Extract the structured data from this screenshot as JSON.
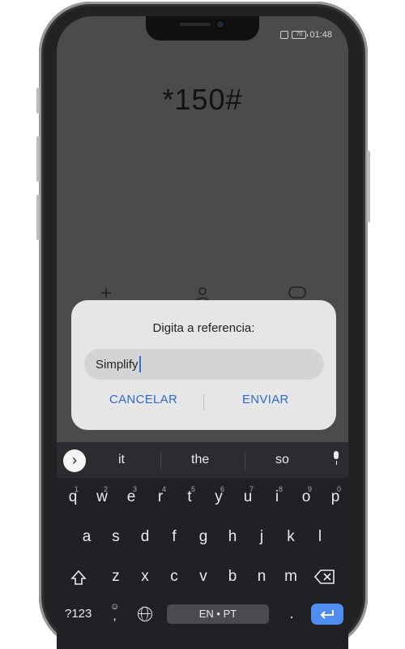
{
  "status_bar": {
    "time": "01:48",
    "battery": "70"
  },
  "dialer": {
    "code": "*150#"
  },
  "dialog": {
    "title": "Digita a referencia:",
    "input_value": "Simplify",
    "cancel_label": "CANCELAR",
    "send_label": "ENVIAR"
  },
  "keyboard": {
    "suggestions": [
      "it",
      "the",
      "so"
    ],
    "row1": [
      "q",
      "w",
      "e",
      "r",
      "t",
      "y",
      "u",
      "i",
      "o",
      "p"
    ],
    "row1_hints": [
      "1",
      "2",
      "3",
      "4",
      "5",
      "6",
      "7",
      "8",
      "9",
      "0"
    ],
    "row2": [
      "a",
      "s",
      "d",
      "f",
      "g",
      "h",
      "j",
      "k",
      "l"
    ],
    "row3": [
      "z",
      "x",
      "c",
      "v",
      "b",
      "n",
      "m"
    ],
    "symbols_label": "?123",
    "emoji_comma": ",",
    "space_label": "EN • PT",
    "period": ".",
    "enter_icon": "enter-arrow-icon"
  },
  "colors": {
    "accent": "#2e6ad1",
    "enter": "#4f8ef0",
    "keyboard_bg": "#202124",
    "dialog_bg": "#e6e6e6"
  }
}
